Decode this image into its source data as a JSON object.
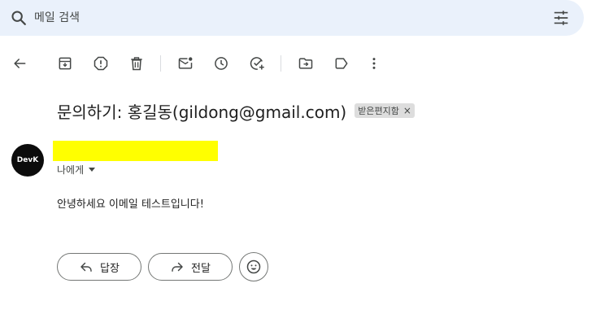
{
  "search": {
    "placeholder": "메일 검색",
    "search_icon": "search-icon",
    "filter_icon": "tune-icon"
  },
  "toolbar": {
    "icons": [
      "back-arrow-icon",
      "archive-icon",
      "report-spam-icon",
      "delete-icon",
      "mark-unread-icon",
      "snooze-icon",
      "add-to-tasks-icon",
      "move-to-icon",
      "label-icon",
      "more-icon"
    ]
  },
  "message": {
    "subject": "문의하기: 홍길동(gildong@gmail.com)",
    "label": "받은편지함",
    "label_close": "×",
    "avatar_text": "DevK",
    "recipient": "나에게",
    "body": "안녕하세요 이메일 테스트입니다!"
  },
  "actions": {
    "reply_label": "답장",
    "forward_label": "전달"
  },
  "colors": {
    "search_bg": "#eaf1fb",
    "redaction": "#ffff00",
    "avatar_bg": "#0c0c0c",
    "chip_bg": "#dddddd"
  }
}
